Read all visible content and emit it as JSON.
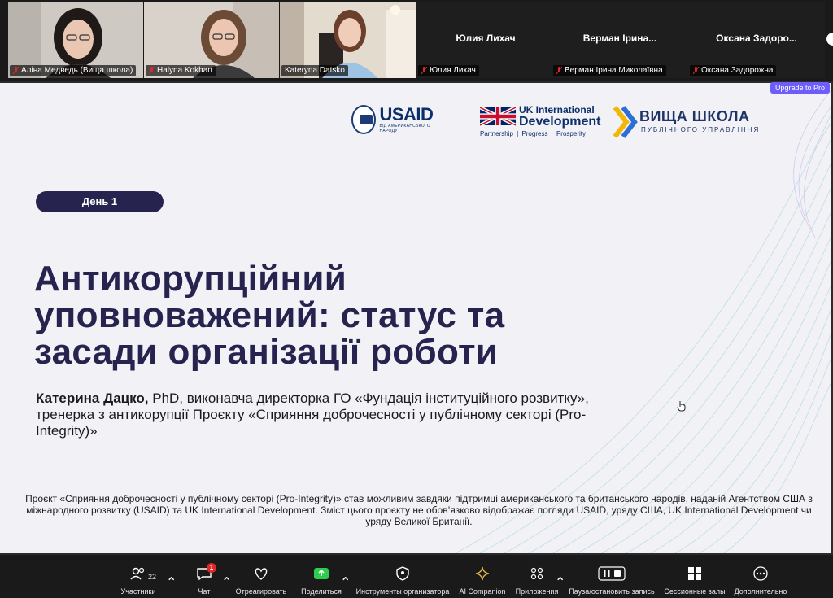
{
  "participants": [
    {
      "name": "Аліна Медведь (Вища школа)",
      "muted": true
    },
    {
      "name": "Halyna Kokhan",
      "muted": true
    },
    {
      "name": "Kateryna Datsko",
      "muted": false,
      "active": true
    },
    {
      "name": "Юлия Лихач",
      "label": "Юлия Лихач",
      "muted": true
    },
    {
      "name": "Верман Ірина Миколаївна",
      "label": "Верман Ірина...",
      "muted": true
    },
    {
      "name": "Оксана Задорожна",
      "label": "Оксана Задоро...",
      "muted": true
    }
  ],
  "upgrade_label": "Upgrade to Pro",
  "slide": {
    "logos": {
      "usaid_text": "USAID",
      "usaid_sub": "ВІД АМЕРИКАНСЬКОГО НАРОДУ",
      "ukid_line1": "UK International",
      "ukid_line2": "Development",
      "ukid_tagline": "Partnership  |  Progress  |  Prosperity",
      "vsh_line1": "ВИЩА ШКОЛА",
      "vsh_line2": "ПУБЛІЧНОГО УПРАВЛІННЯ"
    },
    "day": "День 1",
    "title": "Антикорупційний уповноважений: статус та засади організації роботи",
    "author_name": "Катерина Дацко,",
    "author_rest": " PhD, виконавча директорка ГО «Фундація інституційного розвитку», тренерка з антикорупції Проєкту «Сприяння доброчесності у публічному секторі (Pro-Integrity)»",
    "disclaimer": "Проєкт «Сприяння доброчесності у публічному секторі (Pro-Integrity)» став можливим завдяки підтримці американського та британського народів, наданій Агентством США з міжнародного розвитку (USAID) та UK International Development. Зміст цього проєкту не обов’язково відображає погляди USAID, уряду США, UK International Development чи уряду Великої Британії."
  },
  "toolbar": {
    "participants_label": "Участники",
    "participants_count": "22",
    "chat_label": "Чат",
    "chat_badge": "1",
    "react_label": "Отреагировать",
    "share_label": "Поделиться",
    "host_tools_label": "Инструменты организатора",
    "ai_label": "AI Companion",
    "apps_label": "Приложения",
    "record_label": "Пауза/остановить запись",
    "breakout_label": "Сессионные залы",
    "more_label": "Дополнительно"
  },
  "colors": {
    "accent_green": "#3ecf5b",
    "slide_navy": "#26244f",
    "upgrade_purple": "#6d5dfc",
    "badge_red": "#e02828"
  }
}
